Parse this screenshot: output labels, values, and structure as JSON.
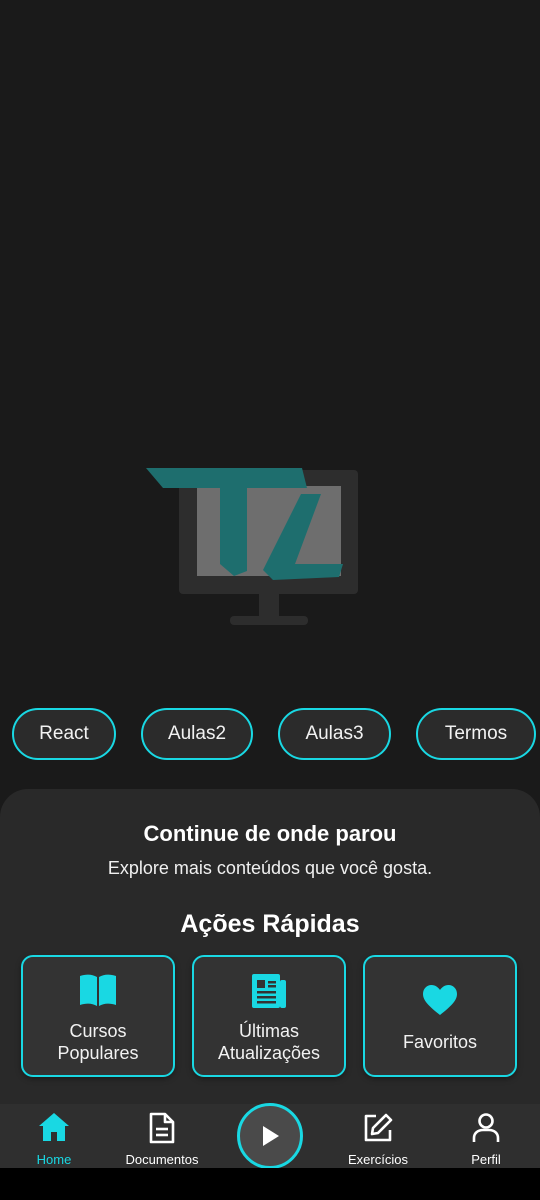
{
  "logo": {
    "icon": "tl-monitor-logo"
  },
  "chips": [
    "React",
    "Aulas2",
    "Aulas3",
    "Termos"
  ],
  "panel": {
    "title": "Continue de onde parou",
    "subtitle": "Explore mais conteúdos que você gosta.",
    "actions_title": "Ações Rápidas",
    "actions": [
      {
        "line1": "Cursos",
        "line2": "Populares",
        "icon": "book-open-icon"
      },
      {
        "line1": "Últimas",
        "line2": "Atualizações",
        "icon": "newspaper-icon"
      },
      {
        "line1": "Favoritos",
        "line2": "",
        "icon": "heart-icon"
      }
    ]
  },
  "nav": {
    "items": [
      {
        "label": "Home",
        "icon": "home-icon",
        "active": true
      },
      {
        "label": "Documentos",
        "icon": "document-icon"
      },
      {
        "label": "",
        "icon": "play-icon"
      },
      {
        "label": "Exercícios",
        "icon": "edit-icon"
      },
      {
        "label": "Perfil",
        "icon": "user-icon"
      }
    ]
  },
  "colors": {
    "accent": "#19d8e3",
    "background": "#1a1a1a",
    "panel": "#292929",
    "card": "#333333"
  }
}
